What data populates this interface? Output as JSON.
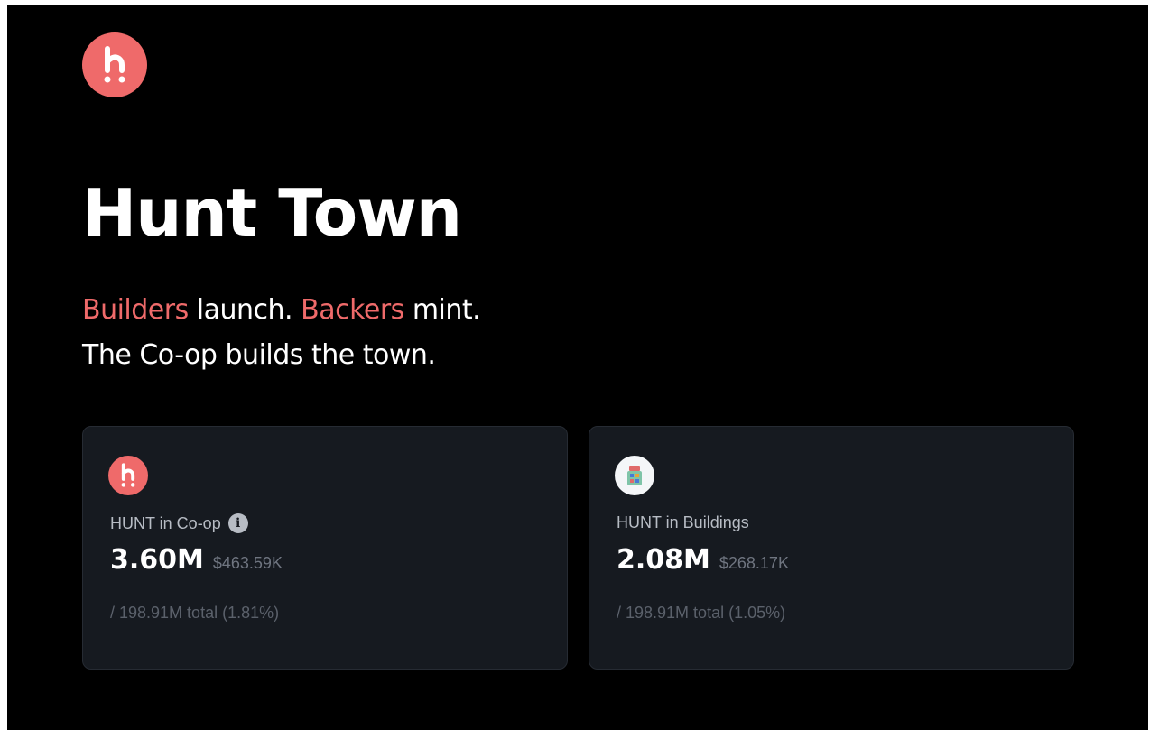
{
  "brand": {
    "logo_icon": "hunt-logo-icon",
    "accent_color": "#ef6a6a"
  },
  "hero": {
    "title": "Hunt Town",
    "tagline": {
      "builders": "Builders",
      "launch": " launch. ",
      "backers": "Backers",
      "mint": " mint.",
      "line2": "The Co-op builds the town."
    }
  },
  "cards": [
    {
      "icon": "hunt-token-icon",
      "label": "HUNT in Co-op",
      "info_icon": "info-icon",
      "amount": "3.60M",
      "usd": "$463.59K",
      "total": "/ 198.91M total (1.81%)"
    },
    {
      "icon": "building-icon",
      "label": "HUNT in Buildings",
      "amount": "2.08M",
      "usd": "$268.17K",
      "total": "/ 198.91M total (1.05%)"
    }
  ]
}
